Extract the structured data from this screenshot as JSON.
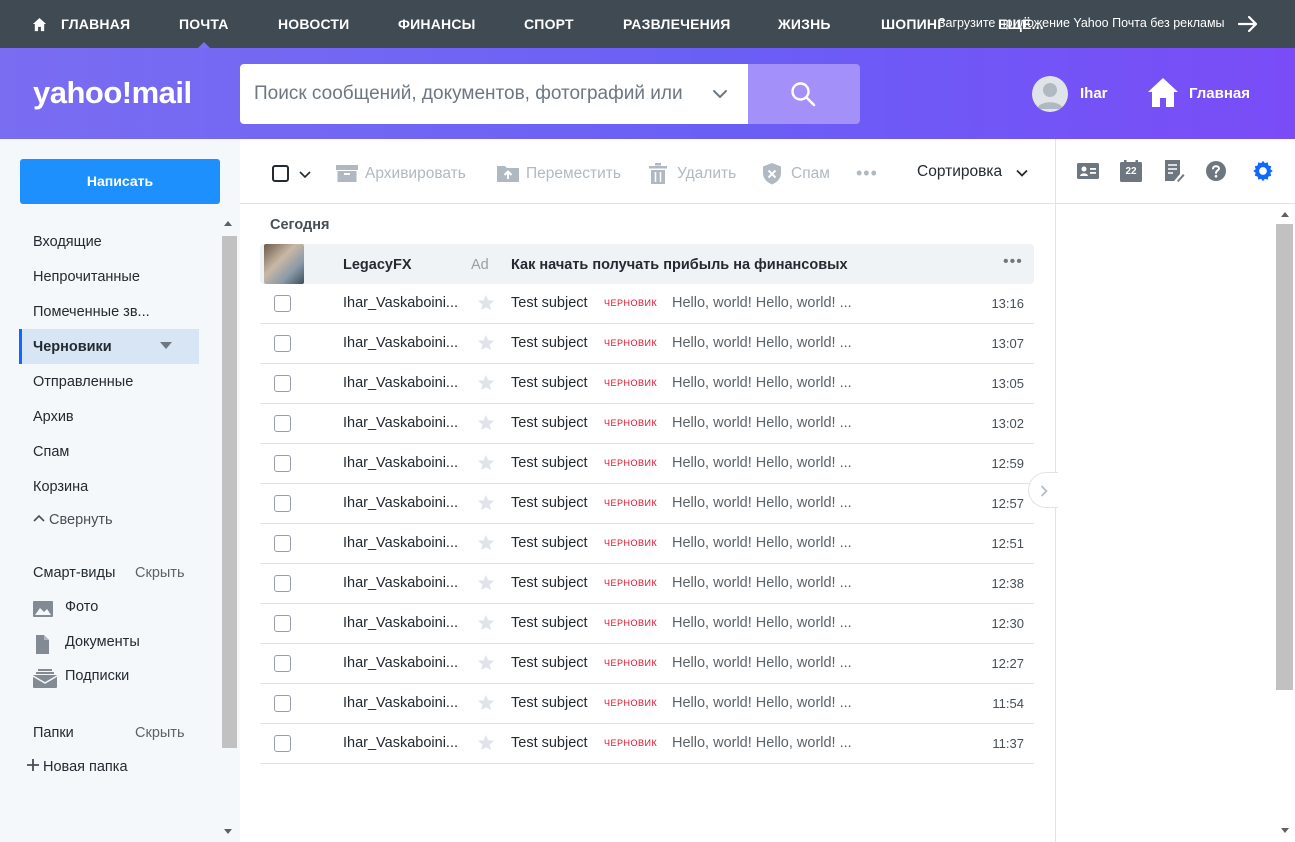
{
  "topnav": {
    "items": [
      {
        "label": "ГЛАВНАЯ",
        "icon": "home-icon"
      },
      {
        "label": "ПОЧТА",
        "active": true
      },
      {
        "label": "НОВОСТИ"
      },
      {
        "label": "ФИНАНСЫ"
      },
      {
        "label": "СПОРТ"
      },
      {
        "label": "РАЗВЛЕЧЕНИЯ"
      },
      {
        "label": "ЖИЗНЬ"
      },
      {
        "label": "ШОПИНГ"
      },
      {
        "label": "ЕЩЁ..."
      }
    ],
    "promo": "Загрузите приложение Yahoo Почта без рекламы"
  },
  "header": {
    "logo": "yahoo!mail",
    "search": {
      "placeholder": "Поиск сообщений, документов, фотографий или"
    },
    "user": {
      "name": "Ihar"
    },
    "home_label": "Главная"
  },
  "sidebar": {
    "compose_label": "Написать",
    "folders": [
      {
        "label": "Входящие"
      },
      {
        "label": "Непрочитанные"
      },
      {
        "label": "Помеченные зв..."
      },
      {
        "label": "Черновики",
        "active": true
      },
      {
        "label": "Отправленные"
      },
      {
        "label": "Архив"
      },
      {
        "label": "Спам"
      },
      {
        "label": "Корзина"
      }
    ],
    "collapse_label": "Свернуть",
    "smart_views": {
      "label": "Смарт-виды",
      "hide_label": "Скрыть",
      "items": [
        {
          "label": "Фото",
          "icon": "photo-icon"
        },
        {
          "label": "Документы",
          "icon": "document-icon"
        },
        {
          "label": "Подписки",
          "icon": "subscriptions-icon"
        }
      ]
    },
    "folders_section": {
      "label": "Папки",
      "hide_label": "Скрыть",
      "new_folder_label": "Новая папка"
    }
  },
  "toolbar": {
    "archive_label": "Архивировать",
    "move_label": "Переместить",
    "delete_label": "Удалить",
    "spam_label": "Спам",
    "more_label": "•••",
    "sort_label": "Сортировка"
  },
  "right_toolbar": {
    "calendar_day": "22",
    "icons": [
      "contacts-icon",
      "calendar-icon",
      "notepad-icon",
      "help-icon",
      "settings-icon"
    ]
  },
  "list": {
    "date_header": "Сегодня",
    "ad": {
      "sender": "LegacyFX",
      "tag": "Ad",
      "subject": "Как начать получать прибыль на финансовых",
      "more": "•••"
    },
    "messages": [
      {
        "sender": "Ihar_Vaskaboini...",
        "subject": "Test subject",
        "draft": "ЧЕРНОВИК",
        "snippet": "Hello, world! Hello, world! ...",
        "time": "13:16"
      },
      {
        "sender": "Ihar_Vaskaboini...",
        "subject": "Test subject",
        "draft": "ЧЕРНОВИК",
        "snippet": "Hello, world! Hello, world! ...",
        "time": "13:07"
      },
      {
        "sender": "Ihar_Vaskaboini...",
        "subject": "Test subject",
        "draft": "ЧЕРНОВИК",
        "snippet": "Hello, world! Hello, world! ...",
        "time": "13:05"
      },
      {
        "sender": "Ihar_Vaskaboini...",
        "subject": "Test subject",
        "draft": "ЧЕРНОВИК",
        "snippet": "Hello, world! Hello, world! ...",
        "time": "13:02"
      },
      {
        "sender": "Ihar_Vaskaboini...",
        "subject": "Test subject",
        "draft": "ЧЕРНОВИК",
        "snippet": "Hello, world! Hello, world! ...",
        "time": "12:59"
      },
      {
        "sender": "Ihar_Vaskaboini...",
        "subject": "Test subject",
        "draft": "ЧЕРНОВИК",
        "snippet": "Hello, world! Hello, world! ...",
        "time": "12:57"
      },
      {
        "sender": "Ihar_Vaskaboini...",
        "subject": "Test subject",
        "draft": "ЧЕРНОВИК",
        "snippet": "Hello, world! Hello, world! ...",
        "time": "12:51"
      },
      {
        "sender": "Ihar_Vaskaboini...",
        "subject": "Test subject",
        "draft": "ЧЕРНОВИК",
        "snippet": "Hello, world! Hello, world! ...",
        "time": "12:38"
      },
      {
        "sender": "Ihar_Vaskaboini...",
        "subject": "Test subject",
        "draft": "ЧЕРНОВИК",
        "snippet": "Hello, world! Hello, world! ...",
        "time": "12:30"
      },
      {
        "sender": "Ihar_Vaskaboini...",
        "subject": "Test subject",
        "draft": "ЧЕРНОВИК",
        "snippet": "Hello, world! Hello, world! ...",
        "time": "12:27"
      },
      {
        "sender": "Ihar_Vaskaboini...",
        "subject": "Test subject",
        "draft": "ЧЕРНОВИК",
        "snippet": "Hello, world! Hello, world! ...",
        "time": "11:54"
      },
      {
        "sender": "Ihar_Vaskaboini...",
        "subject": "Test subject",
        "draft": "ЧЕРНОВИК",
        "snippet": "Hello, world! Hello, world! ...",
        "time": "11:37"
      }
    ]
  },
  "colors": {
    "topnav_bg": "#3f4a53",
    "header_gradient_start": "#7a6df2",
    "header_gradient_end": "#7a4cf7",
    "compose_button": "#1e90fe",
    "draft_badge": "#eb0f29",
    "settings_accent": "#0f69ff"
  }
}
